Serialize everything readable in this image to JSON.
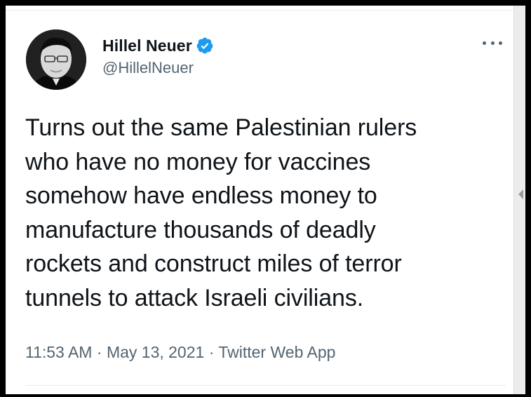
{
  "tweet": {
    "author": {
      "display_name": "Hillel Neuer",
      "handle": "@HillelNeuer",
      "verified": true
    },
    "text_lines": [
      "Turns out the same Palestinian rulers",
      "who have no money for vaccines",
      "somehow have endless money to",
      "manufacture thousands of deadly",
      "rockets and construct miles of terror",
      "tunnels to attack Israeli civilians."
    ],
    "meta": {
      "time": "11:53 AM",
      "separator": "·",
      "date": "May 13, 2021",
      "source": "Twitter Web App"
    }
  },
  "icons": {
    "verified": "verified-badge-icon",
    "more": "more-horizontal-icon",
    "scroll": "scroll-left-arrow-icon"
  },
  "colors": {
    "text": "#0f1419",
    "secondary": "#536471",
    "verified": "#1d9bf0",
    "divider": "#e6ecf0"
  }
}
